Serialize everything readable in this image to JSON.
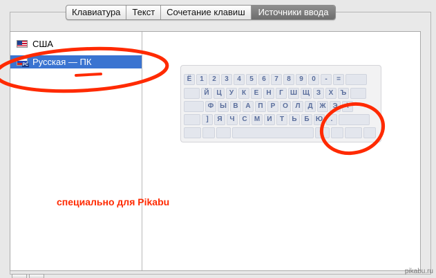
{
  "tabs": [
    {
      "label": "Клавиатура",
      "active": false
    },
    {
      "label": "Текст",
      "active": false
    },
    {
      "label": "Сочетание клавиш",
      "active": false
    },
    {
      "label": "Источники ввода",
      "active": true
    }
  ],
  "input_sources": [
    {
      "label": "США",
      "flag": "us-flag-icon",
      "selected": false
    },
    {
      "label": "Русская — ПК",
      "flag": "ru-flag-icon",
      "flag_badge": "PC",
      "selected": true
    }
  ],
  "keyboard": {
    "rows": [
      [
        "Ё",
        "1",
        "2",
        "3",
        "4",
        "5",
        "6",
        "7",
        "8",
        "9",
        "0",
        "-",
        "=",
        ""
      ],
      [
        "",
        "Й",
        "Ц",
        "У",
        "К",
        "Е",
        "Н",
        "Г",
        "Ш",
        "Щ",
        "З",
        "Х",
        "Ъ",
        ""
      ],
      [
        "",
        "Ф",
        "Ы",
        "В",
        "А",
        "П",
        "Р",
        "О",
        "Л",
        "Д",
        "Ж",
        "Э",
        "\\"
      ],
      [
        "",
        "]",
        "Я",
        "Ч",
        "С",
        "М",
        "И",
        "Т",
        "Ь",
        "Б",
        "Ю",
        ".",
        ""
      ],
      [
        "",
        "",
        "",
        "",
        "",
        "",
        "",
        ""
      ]
    ]
  },
  "annotation": {
    "text": "специально для Pikabu",
    "color": "#ff2a00"
  },
  "watermark": "pikabu.ru",
  "colors": {
    "selection": "#3a74d1",
    "key_text": "#5a6e9c"
  }
}
